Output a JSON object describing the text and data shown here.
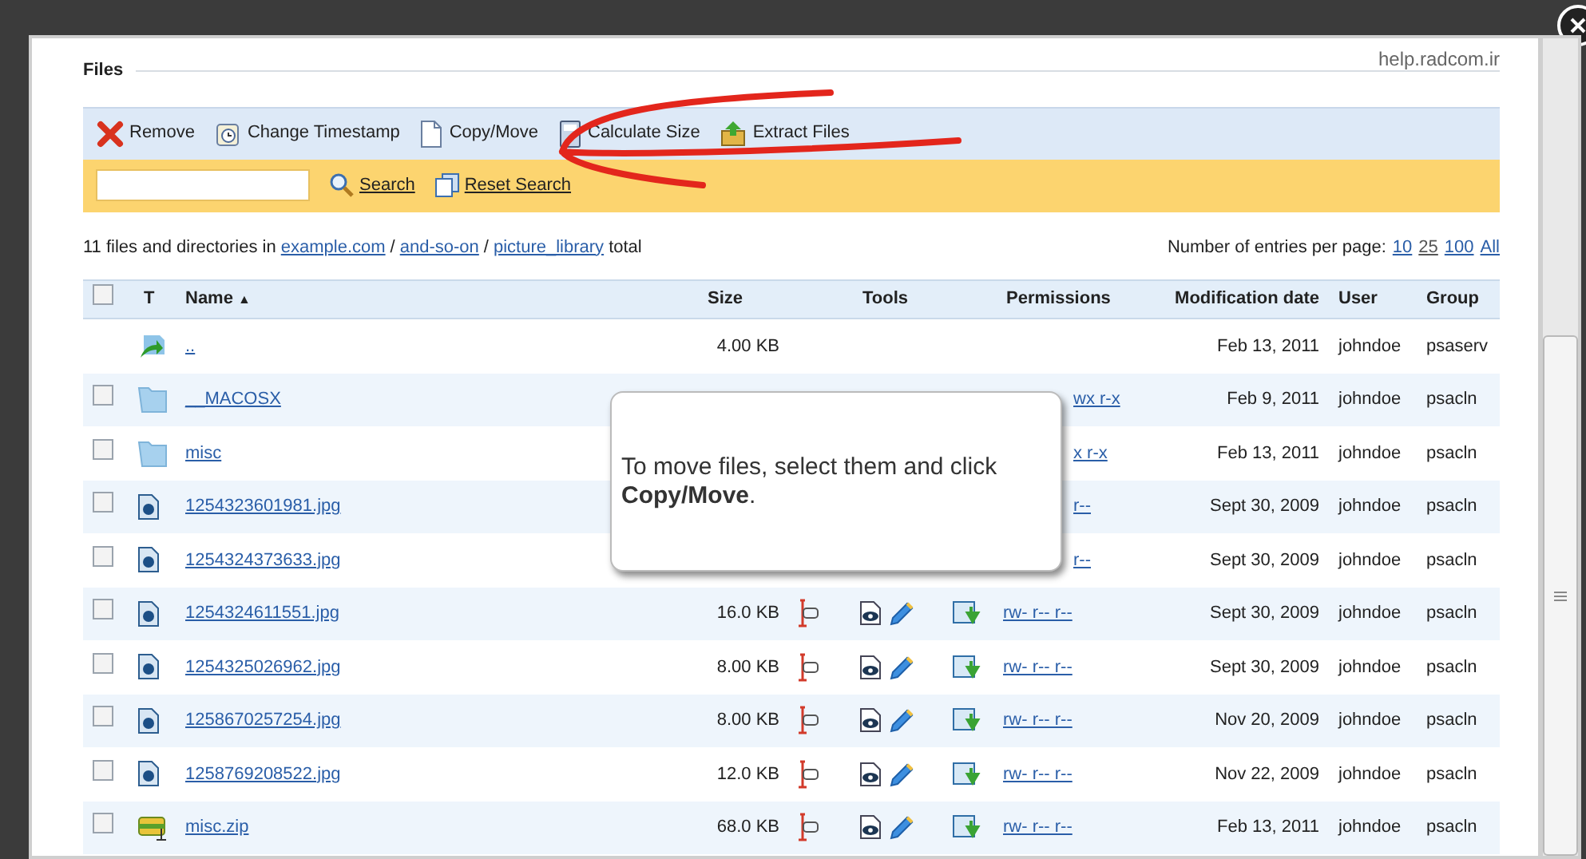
{
  "section": {
    "title": "Files",
    "watermark": "help.radcom.ir"
  },
  "toolbar": [
    {
      "kind": "remove",
      "label": "Remove"
    },
    {
      "kind": "timestamp",
      "label": "Change Timestamp"
    },
    {
      "kind": "copy",
      "label": "Copy/Move"
    },
    {
      "kind": "size",
      "label": "Calculate Size"
    },
    {
      "kind": "extract",
      "label": "Extract Files"
    }
  ],
  "search": {
    "button": "Search",
    "reset": "Reset Search"
  },
  "summary": {
    "prefix": "11 files and directories in",
    "path": [
      "example.com",
      "and-so-on",
      "picture_library"
    ],
    "separator": "/",
    "suffix": "total"
  },
  "page_size": {
    "label": "Number of entries per page:",
    "options": [
      {
        "label": "10",
        "selected": false
      },
      {
        "label": "25",
        "selected": true
      },
      {
        "label": "100",
        "selected": false
      },
      {
        "label": "All",
        "selected": false
      }
    ]
  },
  "table": {
    "header_checked": false,
    "columns": [
      "T",
      "Name",
      "Size",
      "Tools",
      "Permissions",
      "Modification date",
      "User",
      "Group"
    ],
    "sort_mark": "▲",
    "rows": [
      {
        "kind": "parent",
        "name": "..",
        "size": "4.00 KB",
        "tools": false,
        "date": "Feb 13, 2011",
        "user": "johndoe",
        "group": "psaserv"
      },
      {
        "kind": "folder",
        "checked": false,
        "name": "__MACOSX",
        "permissions": "wx r-x",
        "tools": false,
        "covered": true,
        "date": "Feb 9, 2011",
        "user": "johndoe",
        "group": "psacln"
      },
      {
        "kind": "folder",
        "checked": false,
        "name": "misc",
        "permissions": "x r-x",
        "tools": false,
        "covered": true,
        "date": "Feb 13, 2011",
        "user": "johndoe",
        "group": "psacln"
      },
      {
        "kind": "image",
        "checked": false,
        "name": "1254323601981.jpg",
        "permissions": "r--",
        "tools": false,
        "covered": true,
        "date": "Sept 30, 2009",
        "user": "johndoe",
        "group": "psacln"
      },
      {
        "kind": "image",
        "checked": false,
        "name": "1254324373633.jpg",
        "permissions": "r--",
        "tools": false,
        "covered": true,
        "date": "Sept 30, 2009",
        "user": "johndoe",
        "group": "psacln"
      },
      {
        "kind": "image",
        "checked": false,
        "name": "1254324611551.jpg",
        "size": "16.0 KB",
        "permissions": "rw- r-- r--",
        "tools": true,
        "covered": false,
        "date": "Sept 30, 2009",
        "user": "johndoe",
        "group": "psacln"
      },
      {
        "kind": "image",
        "checked": false,
        "name": "1254325026962.jpg",
        "size": "8.00 KB",
        "permissions": "rw- r-- r--",
        "tools": true,
        "covered": false,
        "date": "Sept 30, 2009",
        "user": "johndoe",
        "group": "psacln"
      },
      {
        "kind": "image",
        "checked": false,
        "name": "1258670257254.jpg",
        "size": "8.00 KB",
        "permissions": "rw- r-- r--",
        "tools": true,
        "covered": false,
        "date": "Nov 20, 2009",
        "user": "johndoe",
        "group": "psacln"
      },
      {
        "kind": "image",
        "checked": false,
        "name": "1258769208522.jpg",
        "size": "12.0 KB",
        "permissions": "rw- r-- r--",
        "tools": true,
        "covered": false,
        "date": "Nov 22, 2009",
        "user": "johndoe",
        "group": "psacln"
      },
      {
        "kind": "zip",
        "checked": false,
        "name": "misc.zip",
        "size": "68.0 KB",
        "permissions": "rw- r-- r--",
        "tools": true,
        "covered": false,
        "date": "Feb 13, 2011",
        "user": "johndoe",
        "group": "psacln"
      }
    ]
  },
  "tooltip": {
    "text": "To move files, select them and click **Copy/Move**."
  }
}
